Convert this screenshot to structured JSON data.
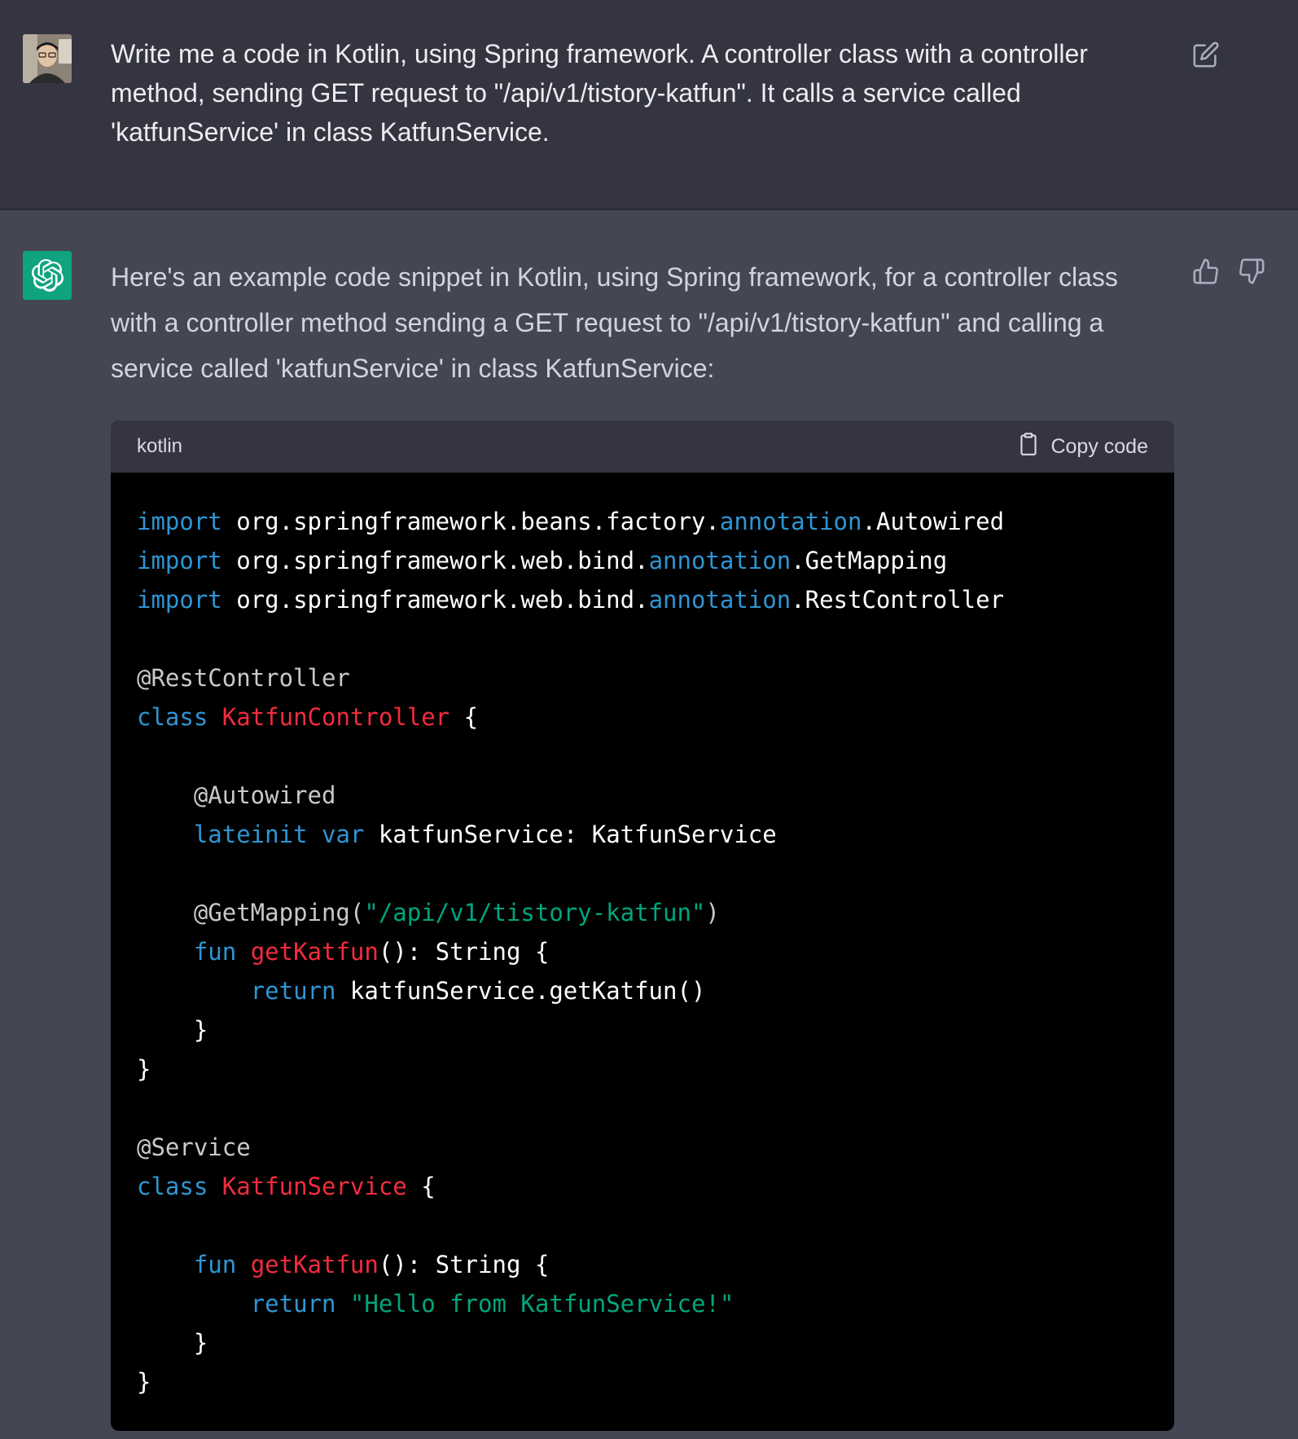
{
  "user_message": {
    "text": "Write me a code in Kotlin, using Spring framework. A controller class with a controller method, sending GET request to \"/api/v1/tistory-katfun\". It calls a service called 'katfunService' in class KatfunService."
  },
  "assistant_message": {
    "intro": "Here's an example code snippet in Kotlin, using Spring framework, for a controller class with a controller method sending a GET request to \"/api/v1/tistory-katfun\" and calling a service called 'katfunService' in class KatfunService:",
    "code_block": {
      "language": "kotlin",
      "copy_label": "Copy code",
      "lines": [
        [
          {
            "t": "import",
            "c": "kw"
          },
          {
            "t": " org.springframework.beans.factory.",
            "c": "pl"
          },
          {
            "t": "annotation",
            "c": "kw"
          },
          {
            "t": ".Autowired",
            "c": "pl"
          }
        ],
        [
          {
            "t": "import",
            "c": "kw"
          },
          {
            "t": " org.springframework.web.bind.",
            "c": "pl"
          },
          {
            "t": "annotation",
            "c": "kw"
          },
          {
            "t": ".GetMapping",
            "c": "pl"
          }
        ],
        [
          {
            "t": "import",
            "c": "kw"
          },
          {
            "t": " org.springframework.web.bind.",
            "c": "pl"
          },
          {
            "t": "annotation",
            "c": "kw"
          },
          {
            "t": ".RestController",
            "c": "pl"
          }
        ],
        [],
        [
          {
            "t": "@RestController",
            "c": "ann"
          }
        ],
        [
          {
            "t": "class",
            "c": "kw"
          },
          {
            "t": " ",
            "c": "pl"
          },
          {
            "t": "KatfunController",
            "c": "fn"
          },
          {
            "t": " {",
            "c": "pl"
          }
        ],
        [],
        [
          {
            "t": "    @Autowired",
            "c": "ann"
          }
        ],
        [
          {
            "t": "    ",
            "c": "pl"
          },
          {
            "t": "lateinit",
            "c": "kw"
          },
          {
            "t": " ",
            "c": "pl"
          },
          {
            "t": "var",
            "c": "kw"
          },
          {
            "t": " katfunService: KatfunService",
            "c": "pl"
          }
        ],
        [],
        [
          {
            "t": "    @GetMapping(",
            "c": "ann"
          },
          {
            "t": "\"/api/v1/tistory-katfun\"",
            "c": "str"
          },
          {
            "t": ")",
            "c": "ann"
          }
        ],
        [
          {
            "t": "    ",
            "c": "pl"
          },
          {
            "t": "fun",
            "c": "kw"
          },
          {
            "t": " ",
            "c": "pl"
          },
          {
            "t": "getKatfun",
            "c": "fn"
          },
          {
            "t": "(): String {",
            "c": "pl"
          }
        ],
        [
          {
            "t": "        ",
            "c": "pl"
          },
          {
            "t": "return",
            "c": "kw"
          },
          {
            "t": " katfunService.getKatfun()",
            "c": "pl"
          }
        ],
        [
          {
            "t": "    }",
            "c": "pl"
          }
        ],
        [
          {
            "t": "}",
            "c": "pl"
          }
        ],
        [],
        [
          {
            "t": "@Service",
            "c": "ann"
          }
        ],
        [
          {
            "t": "class",
            "c": "kw"
          },
          {
            "t": " ",
            "c": "pl"
          },
          {
            "t": "KatfunService",
            "c": "fn"
          },
          {
            "t": " {",
            "c": "pl"
          }
        ],
        [],
        [
          {
            "t": "    ",
            "c": "pl"
          },
          {
            "t": "fun",
            "c": "kw"
          },
          {
            "t": " ",
            "c": "pl"
          },
          {
            "t": "getKatfun",
            "c": "fn"
          },
          {
            "t": "(): String {",
            "c": "pl"
          }
        ],
        [
          {
            "t": "        ",
            "c": "pl"
          },
          {
            "t": "return",
            "c": "kw"
          },
          {
            "t": " ",
            "c": "pl"
          },
          {
            "t": "\"Hello from KatfunService!\"",
            "c": "str"
          }
        ],
        [
          {
            "t": "    }",
            "c": "pl"
          }
        ],
        [
          {
            "t": "}",
            "c": "pl"
          }
        ]
      ]
    }
  },
  "colors": {
    "user_bg": "#343541",
    "assistant_bg": "#444654",
    "code_bg": "#000000",
    "keyword": "#2E95D3",
    "function_name": "#F22C3D",
    "string": "#00A67D",
    "bot_avatar": "#10A37F"
  },
  "icons": {
    "edit": "edit-icon",
    "thumbs_up": "thumbs-up-icon",
    "thumbs_down": "thumbs-down-icon",
    "copy": "clipboard-icon",
    "bot": "openai-logo-icon",
    "user": "user-avatar"
  }
}
